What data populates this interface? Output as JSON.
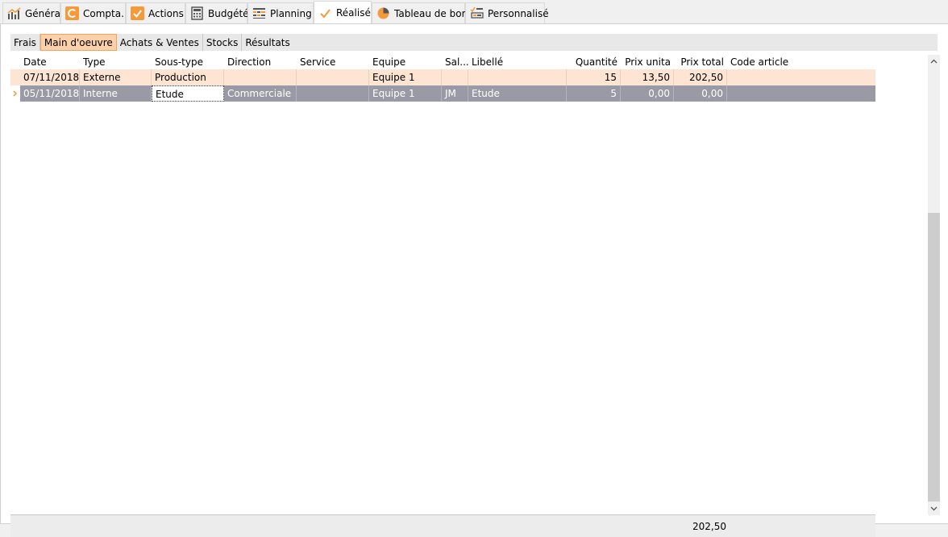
{
  "main_tabs": [
    {
      "label": "Général",
      "icon": "line-chart-icon"
    },
    {
      "label": "Compta.",
      "icon": "accounting-c-icon"
    },
    {
      "label": "Actions",
      "icon": "checkbox-check-icon"
    },
    {
      "label": "Budgété",
      "icon": "calculator-icon"
    },
    {
      "label": "Planning",
      "icon": "planning-grid-icon"
    },
    {
      "label": "Réalisé",
      "icon": "checkmark-icon"
    },
    {
      "label": "Tableau de bord",
      "icon": "pie-chart-icon"
    },
    {
      "label": "Personnalisé",
      "icon": "custom-dashboard-icon"
    }
  ],
  "active_main_tab": "Réalisé",
  "sub_tabs": [
    "Frais",
    "Main d'oeuvre",
    "Achats & Ventes",
    "Stocks",
    "Résultats"
  ],
  "active_sub_tab": "Main d'oeuvre",
  "grid": {
    "columns": [
      "Date",
      "Type",
      "Sous-type",
      "Direction",
      "Service",
      "Equipe",
      "Sal...",
      "Libellé",
      "Quantité",
      "Prix unita",
      "Prix total",
      "Code article"
    ],
    "rows": [
      {
        "date": "07/11/2018",
        "type": "Externe",
        "sous_type": "Production",
        "direction": "",
        "service": "",
        "equipe": "Equipe 1",
        "sal": "",
        "libelle": "",
        "quantite": "15",
        "prix_unitaire": "13,50",
        "prix_total": "202,50",
        "code_article": ""
      },
      {
        "date": "05/11/2018",
        "type": "Interne",
        "sous_type": "Etude",
        "direction": "Commerciale",
        "service": "",
        "equipe": "Equipe 1",
        "sal": "JM",
        "libelle": "Etude",
        "quantite": "5",
        "prix_unitaire": "0,00",
        "prix_total": "0,00",
        "code_article": ""
      }
    ],
    "total_prix": "202,50"
  },
  "colors": {
    "accent": "#f59a3a",
    "selected_row": "#9a9aa6",
    "alt_row": "#fde4d3",
    "active_subtab": "#fcd0a8"
  }
}
